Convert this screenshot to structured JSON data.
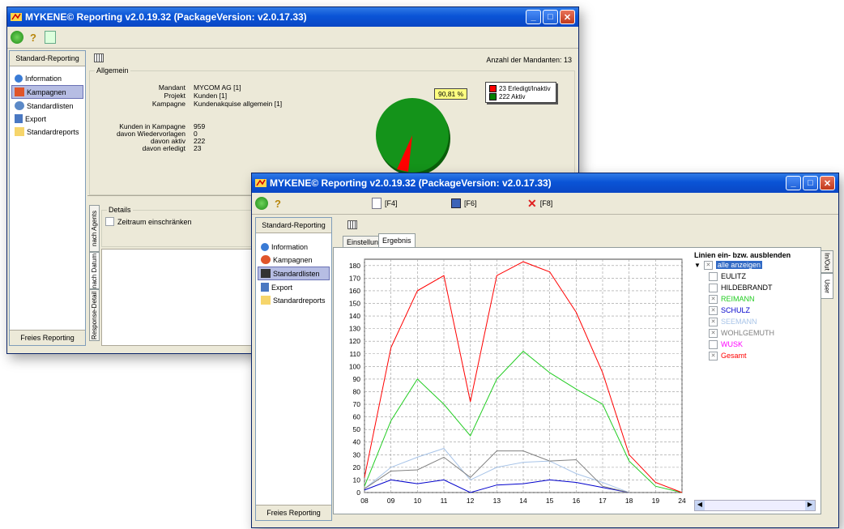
{
  "back_window": {
    "title": "MYKENE© Reporting v2.0.19.32 (PackageVersion: v2.0.17.33)",
    "panel_header": "Standard-Reporting",
    "panel_footer": "Freies Reporting",
    "nav": [
      {
        "label": "Information",
        "icon": "info-icon"
      },
      {
        "label": "Kampagnen",
        "icon": "campaign-icon",
        "selected": true
      },
      {
        "label": "Standardlisten",
        "icon": "lists-icon"
      },
      {
        "label": "Export",
        "icon": "export-icon"
      },
      {
        "label": "Standardreports",
        "icon": "folder-icon"
      }
    ],
    "mandanten_count": "Anzahl der Mandanten: 13",
    "group_allgemein": "Allgemein",
    "info": [
      {
        "key": "Mandant",
        "value": "MYCOM AG [1]"
      },
      {
        "key": "Projekt",
        "value": "Kunden [1]"
      },
      {
        "key": "Kampagne",
        "value": "Kundenakquise allgemein [1]"
      }
    ],
    "stats": [
      {
        "key": "Kunden in Kampagne",
        "value": "959"
      },
      {
        "key": "davon Wiedervorlagen",
        "value": "0"
      },
      {
        "key": "davon aktiv",
        "value": "222"
      },
      {
        "key": "davon erledigt",
        "value": "23"
      }
    ],
    "pie_label": "90,81 %",
    "pie_legend": [
      {
        "label": "23 Erledigt/Inaktiv",
        "color": "#ff0000"
      },
      {
        "label": "222 Aktiv",
        "color": "#008000"
      }
    ],
    "details_title": "Details",
    "zeitraum_label": "Zeitraum einschränken",
    "vtabs": [
      "nach Agents",
      "nach Datum",
      "Response-Detail"
    ]
  },
  "front_window": {
    "title": "MYKENE© Reporting v2.0.19.32 (PackageVersion: v2.0.17.33)",
    "toolbar": {
      "f4": "[F4]",
      "f6": "[F6]",
      "f8": "[F8]"
    },
    "panel_header": "Standard-Reporting",
    "panel_footer": "Freies Reporting",
    "nav": [
      {
        "label": "Information",
        "icon": "info-icon"
      },
      {
        "label": "Kampagnen",
        "icon": "campaign-icon"
      },
      {
        "label": "Standardlisten",
        "icon": "lists-icon",
        "selected": true
      },
      {
        "label": "Export",
        "icon": "export-icon"
      },
      {
        "label": "Standardreports",
        "icon": "folder-icon"
      }
    ],
    "tabs": [
      {
        "label": "Einstellung"
      },
      {
        "label": "Ergebnis",
        "active": true
      }
    ],
    "legend_title": "Linien ein- bzw. ausblenden",
    "legend_all": "alle anzeigen",
    "side_tabs": [
      "In/Out",
      "User"
    ]
  },
  "chart_data": {
    "type": "line",
    "x": [
      "08",
      "09",
      "10",
      "11",
      "12",
      "13",
      "14",
      "15",
      "16",
      "17",
      "18",
      "19",
      "24"
    ],
    "ylim": [
      0,
      185
    ],
    "yticks": [
      0,
      10,
      20,
      30,
      40,
      50,
      60,
      70,
      80,
      90,
      100,
      110,
      120,
      130,
      140,
      150,
      160,
      170,
      180
    ],
    "grid": true,
    "series": [
      {
        "name": "EULITZ",
        "color": "#ffffff",
        "visible": false,
        "values": []
      },
      {
        "name": "HILDEBRANDT",
        "color": "#b8860b",
        "visible": false,
        "values": []
      },
      {
        "name": "REIMANN",
        "color": "#22cc22",
        "visible": true,
        "values": [
          5,
          57,
          90,
          70,
          45,
          90,
          112,
          95,
          82,
          70,
          25,
          5,
          0
        ]
      },
      {
        "name": "SCHULZ",
        "color": "#0000cc",
        "visible": true,
        "values": [
          2,
          10,
          7,
          10,
          0,
          6,
          7,
          10,
          8,
          4,
          0,
          null,
          null
        ]
      },
      {
        "name": "SEEMANN",
        "color": "#a8c4e8",
        "visible": true,
        "values": [
          3,
          20,
          28,
          35,
          10,
          20,
          24,
          25,
          15,
          8,
          0,
          null,
          null
        ]
      },
      {
        "name": "WOHLGEMUTH",
        "color": "#808080",
        "visible": true,
        "values": [
          3,
          17,
          18,
          28,
          12,
          33,
          33,
          25,
          26,
          5,
          0,
          null,
          null
        ]
      },
      {
        "name": "WUSK",
        "color": "#ff00ff",
        "visible": false,
        "values": []
      },
      {
        "name": "Gesamt",
        "color": "#ff0000",
        "visible": true,
        "values": [
          12,
          115,
          160,
          172,
          72,
          172,
          183,
          175,
          143,
          95,
          30,
          8,
          0
        ]
      }
    ]
  }
}
